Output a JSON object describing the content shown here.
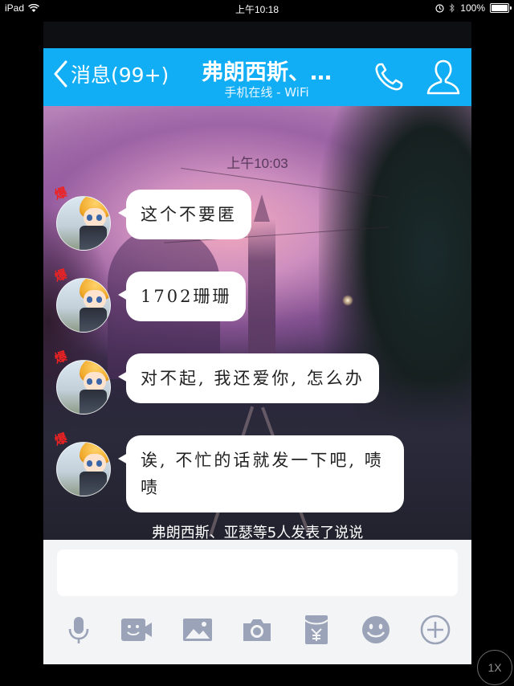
{
  "status_bar": {
    "device": "iPad",
    "time": "上午10:18",
    "battery": "100%",
    "battery_level": 1.0
  },
  "navbar": {
    "back_label": "消息(99+)",
    "title": "弗朗西斯、…",
    "subtitle": "手机在线 - WiFi",
    "background": "#12aef5"
  },
  "chat": {
    "timestamp": "上午10:03",
    "messages": [
      {
        "text": "这个不要匿"
      },
      {
        "text": "1702珊珊"
      },
      {
        "text": "对不起, 我还爱你, 怎么办"
      },
      {
        "text": "诶, 不忙的话就发一下吧, 啧啧"
      }
    ],
    "avatar_badge": "爆",
    "notice": "弗朗西斯、亚瑟等5人发表了说说"
  },
  "composer": {
    "input_value": "",
    "tools": [
      "microphone-icon",
      "video-call-icon",
      "picture-icon",
      "camera-icon",
      "red-packet-icon",
      "emoji-icon",
      "plus-icon"
    ],
    "icon_color": "#9ba3b8"
  },
  "zoom_button": "1X"
}
